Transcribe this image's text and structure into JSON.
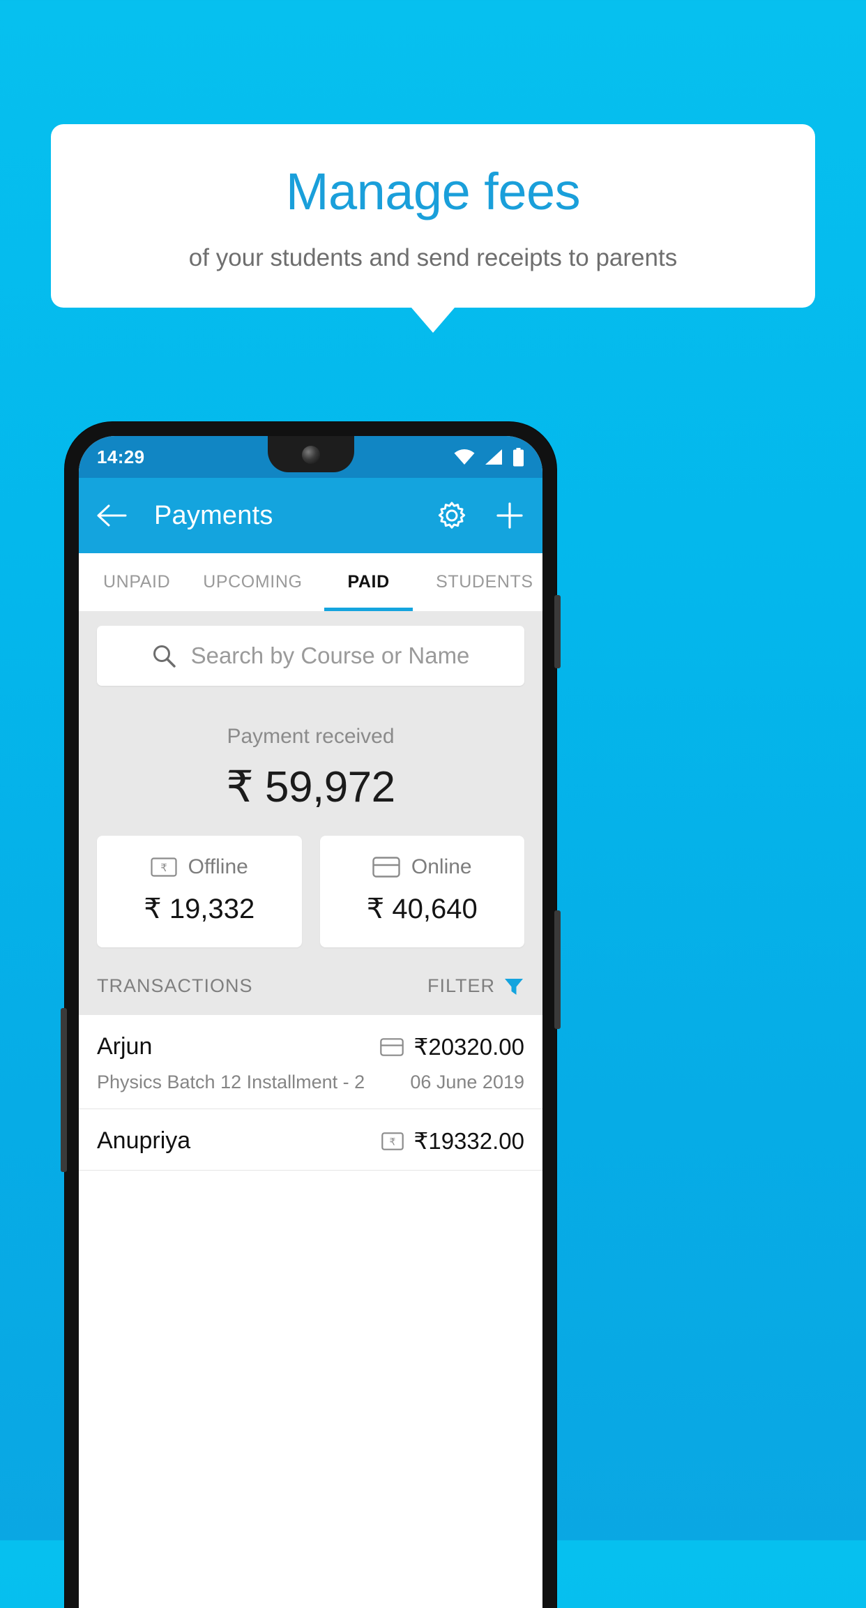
{
  "promo": {
    "title": "Manage fees",
    "subtitle": "of your students and send receipts to parents",
    "title_color": "#1a9fda",
    "background_color": "#06b9ee"
  },
  "status_bar": {
    "time": "14:29",
    "icons": [
      "wifi-icon",
      "cellular-signal-icon",
      "battery-icon"
    ]
  },
  "app_bar": {
    "back_label": "",
    "title": "Payments",
    "settings_icon": "gear-icon",
    "add_icon": "plus-icon",
    "background_color": "#14a4de"
  },
  "tabs": [
    {
      "label": "UNPAID",
      "active": false
    },
    {
      "label": "UPCOMING",
      "active": false
    },
    {
      "label": "PAID",
      "active": true
    },
    {
      "label": "STUDENTS",
      "active": false
    }
  ],
  "search": {
    "placeholder": "Search by Course or Name",
    "value": "",
    "icon": "search-icon"
  },
  "summary": {
    "label": "Payment received",
    "amount": "₹ 59,972"
  },
  "method_cards": [
    {
      "label": "Offline",
      "amount": "₹ 19,332",
      "icon": "banknote-rupee-icon"
    },
    {
      "label": "Online",
      "amount": "₹ 40,640",
      "icon": "credit-card-icon"
    }
  ],
  "transactions_section": {
    "title": "TRANSACTIONS",
    "filter_label": "FILTER",
    "filter_icon": "funnel-icon",
    "filter_icon_color": "#14a4de"
  },
  "transactions": [
    {
      "name": "Arjun",
      "amount": "₹20320.00",
      "description": "Physics Batch 12 Installment - 2",
      "date": "06 June 2019",
      "method_icon": "credit-card-icon"
    },
    {
      "name": "Anupriya",
      "amount": "₹19332.00",
      "description": "",
      "date": "",
      "method_icon": "banknote-rupee-icon"
    }
  ]
}
